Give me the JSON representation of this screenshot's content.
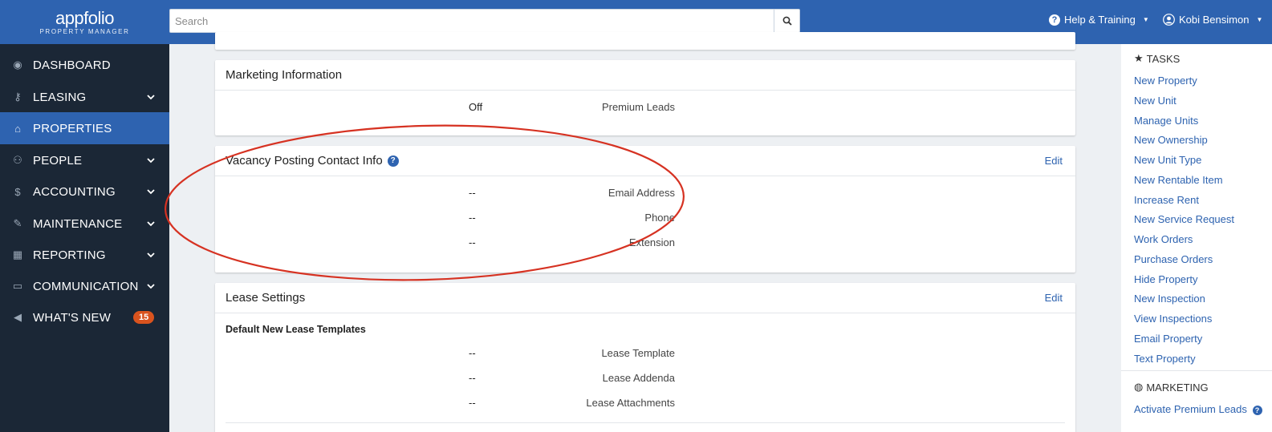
{
  "header": {
    "logo_word": "appfolio",
    "logo_sub": "PROPERTY MANAGER",
    "search_placeholder": "Search",
    "help_label": "Help & Training",
    "user_name": "Kobi Bensimon"
  },
  "sidebar": {
    "items": [
      {
        "label": "DASHBOARD",
        "icon": "dashboard-icon",
        "chevron": false
      },
      {
        "label": "LEASING",
        "icon": "key-icon",
        "chevron": true
      },
      {
        "label": "PROPERTIES",
        "icon": "home-icon",
        "chevron": false,
        "active": true
      },
      {
        "label": "PEOPLE",
        "icon": "users-icon",
        "chevron": true
      },
      {
        "label": "ACCOUNTING",
        "icon": "dollar-icon",
        "chevron": true
      },
      {
        "label": "MAINTENANCE",
        "icon": "wrench-icon",
        "chevron": true
      },
      {
        "label": "REPORTING",
        "icon": "table-icon",
        "chevron": true
      },
      {
        "label": "COMMUNICATION",
        "icon": "inbox-icon",
        "chevron": true
      },
      {
        "label": "WHAT'S NEW",
        "icon": "megaphone-icon",
        "chevron": false,
        "badge": "15"
      }
    ]
  },
  "marketing_info": {
    "title": "Marketing Information",
    "rows": [
      {
        "label": "Premium Leads",
        "value": "Off"
      }
    ]
  },
  "vacancy_contact": {
    "title": "Vacancy Posting Contact Info",
    "edit": "Edit",
    "rows": [
      {
        "label": "Email Address",
        "value": "--"
      },
      {
        "label": "Phone",
        "value": "--"
      },
      {
        "label": "Extension",
        "value": "--"
      }
    ]
  },
  "lease_settings": {
    "title": "Lease Settings",
    "edit": "Edit",
    "subheading": "Default New Lease Templates",
    "rows": [
      {
        "label": "Lease Template",
        "value": "--"
      },
      {
        "label": "Lease Addenda",
        "value": "--"
      },
      {
        "label": "Lease Attachments",
        "value": "--"
      }
    ]
  },
  "tasks": {
    "title": "TASKS",
    "links": [
      "New Property",
      "New Unit",
      "Manage Units",
      "New Ownership",
      "New Unit Type",
      "New Rentable Item",
      "Increase Rent",
      "New Service Request",
      "Work Orders",
      "Purchase Orders",
      "Hide Property",
      "New Inspection",
      "View Inspections",
      "Email Property",
      "Text Property"
    ]
  },
  "marketing": {
    "title": "MARKETING",
    "link": "Activate Premium Leads"
  },
  "colors": {
    "brand_blue": "#2e63b0",
    "sidebar_bg": "#1b2736",
    "badge_orange": "#d9531e",
    "annotation_red": "#d63222"
  }
}
